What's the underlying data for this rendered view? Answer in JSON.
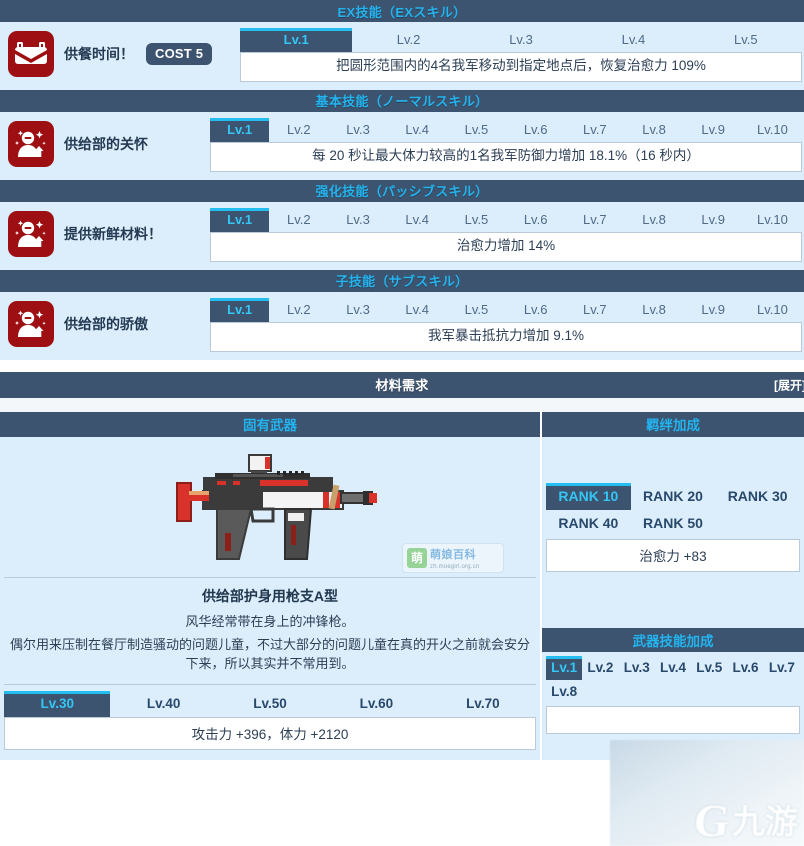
{
  "sections": [
    {
      "id": "ex",
      "title": "EX技能（EXスキル）",
      "skill": {
        "icon": "lunchbox-icon",
        "name": "供餐时间！",
        "cost": "COST 5",
        "levels": [
          "Lv.1",
          "Lv.2",
          "Lv.3",
          "Lv.4",
          "Lv.5"
        ],
        "active_level": "Lv.1",
        "description": "把圆形范围内的4名我军移动到指定地点后，恢复治愈力 109%"
      }
    },
    {
      "id": "normal",
      "title": "基本技能（ノーマルスキル）",
      "skill": {
        "icon": "support-buff-icon",
        "name": "供给部的关怀",
        "cost": "",
        "levels": [
          "Lv.1",
          "Lv.2",
          "Lv.3",
          "Lv.4",
          "Lv.5",
          "Lv.6",
          "Lv.7",
          "Lv.8",
          "Lv.9",
          "Lv.10"
        ],
        "active_level": "Lv.1",
        "description": "每 20 秒让最大体力较高的1名我军防御力增加 18.1%（16 秒内）"
      }
    },
    {
      "id": "passive",
      "title": "强化技能（パッシブスキル）",
      "skill": {
        "icon": "support-buff-icon",
        "name": "提供新鲜材料！",
        "cost": "",
        "levels": [
          "Lv.1",
          "Lv.2",
          "Lv.3",
          "Lv.4",
          "Lv.5",
          "Lv.6",
          "Lv.7",
          "Lv.8",
          "Lv.9",
          "Lv.10"
        ],
        "active_level": "Lv.1",
        "description": "治愈力增加 14%"
      }
    },
    {
      "id": "sub",
      "title": "子技能（サブスキル）",
      "skill": {
        "icon": "support-buff-icon",
        "name": "供给部的骄傲",
        "cost": "",
        "levels": [
          "Lv.1",
          "Lv.2",
          "Lv.3",
          "Lv.4",
          "Lv.5",
          "Lv.6",
          "Lv.7",
          "Lv.8",
          "Lv.9",
          "Lv.10"
        ],
        "active_level": "Lv.1",
        "description": "我军暴击抵抗力增加 9.1%"
      }
    }
  ],
  "material": {
    "title": "材料需求",
    "expand_label": "[展开]"
  },
  "weapon": {
    "column_title": "固有武器",
    "image_alt": "submachine-gun",
    "name": "供给部护身用枪支A型",
    "subtitle": "风华经常带在身上的冲锋枪。",
    "description": "偶尔用来压制在餐厅制造骚动的问题儿童，不过大部分的问题儿童在真的开火之前就会安分下来，所以其实并不常用到。",
    "levels": [
      "Lv.30",
      "Lv.40",
      "Lv.50",
      "Lv.60",
      "Lv.70"
    ],
    "active_level": "Lv.30",
    "stats": "攻击力 +396，体力 +2120"
  },
  "bond": {
    "column_title": "羁绊加成",
    "ranks": [
      "RANK 10",
      "RANK 20",
      "RANK 30",
      "RANK 40",
      "RANK 50"
    ],
    "active_rank": "RANK 10",
    "effect": "治愈力 +83"
  },
  "weapon_skill": {
    "title": "武器技能加成",
    "levels": [
      "Lv.1",
      "Lv.2",
      "Lv.3",
      "Lv.4",
      "Lv.5",
      "Lv.6",
      "Lv.7",
      "Lv.8"
    ],
    "active_level": "Lv.1",
    "second_row_label": "Lv.8"
  },
  "watermark": {
    "brand": "萌",
    "name": "萌娘百科",
    "url": "zh.moegirl.org.cn"
  },
  "overlay_watermark": {
    "mark": "G",
    "label": "九游"
  },
  "colors": {
    "header_bar": "#3c546f",
    "header_text": "#23b3ef",
    "panel_bg": "#dceefc",
    "accent": "#24bdf0",
    "icon_bg": "#9e0f13",
    "active_tab_text": "#34c6f4"
  }
}
